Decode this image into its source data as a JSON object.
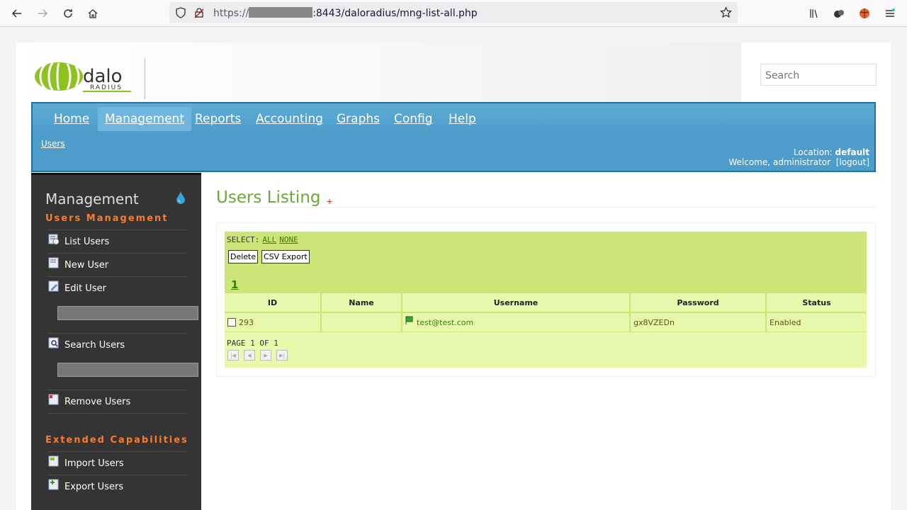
{
  "browser": {
    "url_prefix": "https://",
    "url_suffix": ":8443/daloradius/mng-list-all.php"
  },
  "header": {
    "logo_text_top": "dalo",
    "logo_text_bottom": "RADIUS",
    "search_placeholder": "Search"
  },
  "topnav": {
    "items": [
      "Home",
      "Management",
      "Reports",
      "Accounting",
      "Graphs",
      "Config",
      "Help"
    ],
    "active": "Management",
    "submenu": "Users",
    "location_label": "Location:",
    "location_value": "default",
    "welcome": "Welcome, administrator",
    "logout": "[logout]"
  },
  "sidebar": {
    "title": "Management",
    "section1": "Users Management",
    "section2": "Extended Capabilities",
    "items": [
      "List Users",
      "New User",
      "Edit User",
      "Search Users",
      "Remove Users",
      "Import Users",
      "Export Users"
    ]
  },
  "main": {
    "title": "Users Listing",
    "star": "+",
    "select_label": "SELECT:",
    "select_all": "ALL",
    "select_none": "NONE",
    "delete_button": "Delete",
    "csv_button": "CSV Export",
    "page_link": "1",
    "columns": [
      "ID",
      "Name",
      "Username",
      "Password",
      "Status"
    ],
    "rows": [
      {
        "id": "293",
        "name": "",
        "username": "test@test.com",
        "password": "gx8VZEDn",
        "status": "Enabled"
      }
    ],
    "page_info": "PAGE 1 OF 1"
  }
}
